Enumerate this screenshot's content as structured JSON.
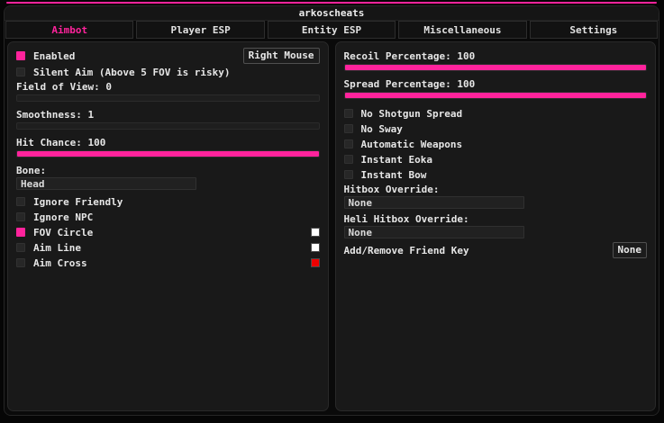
{
  "colors": {
    "accent": "#ff239c",
    "swatch_white": "#ffffff",
    "swatch_red": "#ee0000"
  },
  "window_title": "arkoscheats",
  "tabs": {
    "items": [
      {
        "label": "Aimbot",
        "active": true
      },
      {
        "label": "Player ESP",
        "active": false
      },
      {
        "label": "Entity ESP",
        "active": false
      },
      {
        "label": "Miscellaneous",
        "active": false
      },
      {
        "label": "Settings",
        "active": false
      }
    ]
  },
  "aimbot": {
    "enabled_label": "Enabled",
    "enabled_checked": true,
    "keybind_button": "Right Mouse",
    "silent_aim_label": "Silent Aim (Above 5 FOV is risky)",
    "silent_aim_checked": false,
    "fov_label": "Field of View: 0",
    "fov_fill_percent": 0,
    "smoothness_label": "Smoothness: 1",
    "smoothness_fill_percent": 0,
    "hit_chance_label": "Hit Chance: 100",
    "hit_chance_fill_percent": 100,
    "bone_label": "Bone:",
    "bone_value": "Head",
    "ignore_friendly_label": "Ignore Friendly",
    "ignore_friendly_checked": false,
    "ignore_npc_label": "Ignore NPC",
    "ignore_npc_checked": false,
    "fov_circle_label": "FOV Circle",
    "fov_circle_checked": true,
    "aim_line_label": "Aim Line",
    "aim_line_checked": false,
    "aim_cross_label": "Aim Cross",
    "aim_cross_checked": false
  },
  "weapons": {
    "recoil_label": "Recoil Percentage: 100",
    "recoil_fill_percent": 100,
    "spread_label": "Spread Percentage: 100",
    "spread_fill_percent": 100,
    "no_shotgun_spread_label": "No Shotgun Spread",
    "no_shotgun_spread_checked": false,
    "no_sway_label": "No Sway",
    "no_sway_checked": false,
    "automatic_weapons_label": "Automatic Weapons",
    "automatic_weapons_checked": false,
    "instant_eoka_label": "Instant Eoka",
    "instant_eoka_checked": false,
    "instant_bow_label": "Instant Bow",
    "instant_bow_checked": false,
    "hitbox_override_label": "Hitbox Override:",
    "hitbox_override_value": "None",
    "heli_hitbox_override_label": "Heli Hitbox Override:",
    "heli_hitbox_override_value": "None",
    "friend_key_label": "Add/Remove Friend Key",
    "friend_key_button": "None"
  }
}
